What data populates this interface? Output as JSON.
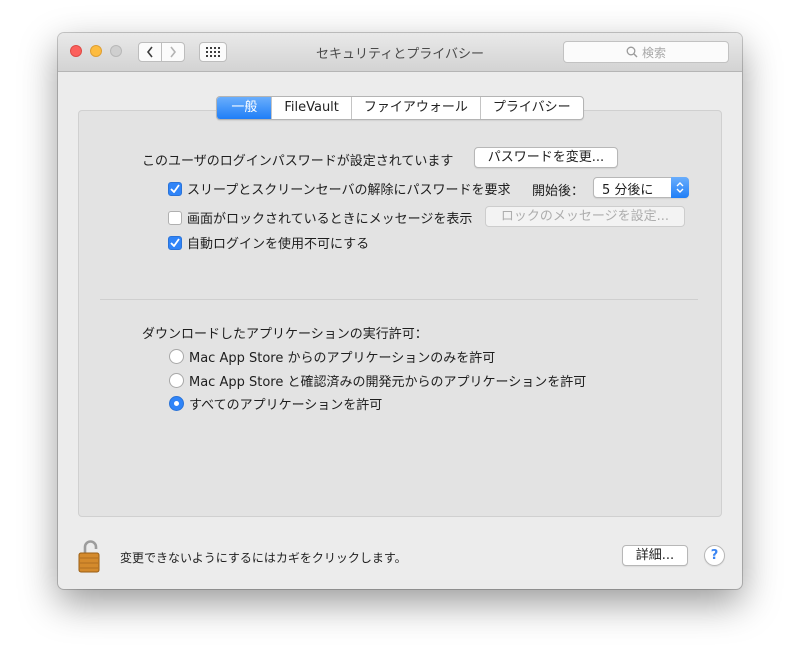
{
  "window": {
    "title": "セキュリティとプライバシー"
  },
  "toolbar": {
    "search_placeholder": "検索"
  },
  "tabs": [
    {
      "label": "一般",
      "active": true
    },
    {
      "label": "FileVault",
      "active": false
    },
    {
      "label": "ファイアウォール",
      "active": false
    },
    {
      "label": "プライバシー",
      "active": false
    }
  ],
  "general": {
    "login_password_label": "このユーザのログインパスワードが設定されています",
    "change_password_button": "パスワードを変更...",
    "require_password": {
      "label": "スリープとスクリーンセーバの解除にパスワードを要求",
      "checked": true
    },
    "start_after_label": "開始後：",
    "start_after_value": "5 分後に",
    "show_message": {
      "label": "画面がロックされているときにメッセージを表示",
      "checked": false
    },
    "set_lock_message_button": "ロックのメッセージを設定...",
    "disable_auto_login": {
      "label": "自動ログインを使用不可にする",
      "checked": true
    },
    "download_apps_label": "ダウンロードしたアプリケーションの実行許可：",
    "radio_options": [
      {
        "label": "Mac App Store からのアプリケーションのみを許可",
        "selected": false
      },
      {
        "label": "Mac App Store と確認済みの開発元からのアプリケーションを許可",
        "selected": false
      },
      {
        "label": "すべてのアプリケーションを許可",
        "selected": true
      }
    ]
  },
  "footer": {
    "lock_text": "変更できないようにするにはカギをクリックします。",
    "advanced_button": "詳細...",
    "help_button": "?"
  },
  "colors": {
    "accent": "#2f84f8",
    "close": "#fc605c",
    "minimize": "#fdbc40"
  }
}
